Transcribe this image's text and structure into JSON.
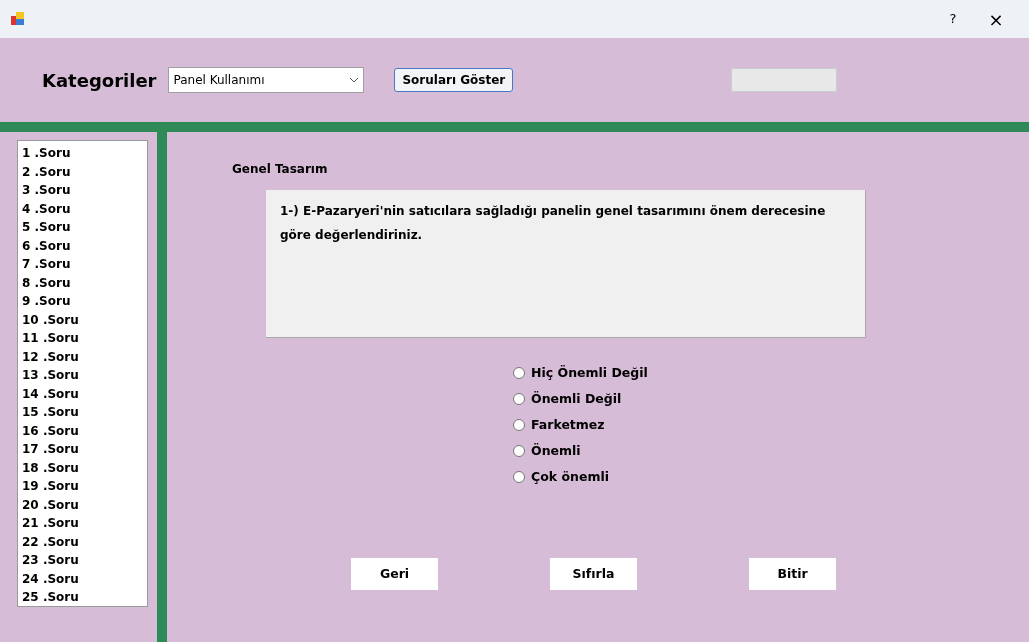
{
  "title_bar": {
    "help": "?",
    "close": "×"
  },
  "header": {
    "label": "Kategoriler",
    "category": "Panel Kullanımı",
    "show_button": "Soruları Göster"
  },
  "questions": [
    {
      "label": "1 .Soru"
    },
    {
      "label": "2 .Soru"
    },
    {
      "label": "3 .Soru"
    },
    {
      "label": "4 .Soru"
    },
    {
      "label": "5 .Soru"
    },
    {
      "label": "6 .Soru"
    },
    {
      "label": "7 .Soru"
    },
    {
      "label": "8 .Soru"
    },
    {
      "label": "9 .Soru"
    },
    {
      "label": "10 .Soru"
    },
    {
      "label": "11 .Soru"
    },
    {
      "label": "12 .Soru"
    },
    {
      "label": "13 .Soru"
    },
    {
      "label": "14 .Soru"
    },
    {
      "label": "15 .Soru"
    },
    {
      "label": "16 .Soru"
    },
    {
      "label": "17 .Soru"
    },
    {
      "label": "18 .Soru"
    },
    {
      "label": "19 .Soru"
    },
    {
      "label": "20 .Soru"
    },
    {
      "label": "21 .Soru"
    },
    {
      "label": "22 .Soru"
    },
    {
      "label": "23 .Soru"
    },
    {
      "label": "24 .Soru"
    },
    {
      "label": "25 .Soru"
    }
  ],
  "section": "Genel Tasarım",
  "question_text": "1-) E-Pazaryeri'nin satıcılara sağladığı panelin genel tasarımını önem derecesine göre değerlendiriniz.",
  "options": [
    {
      "label": "Hiç Önemli Değil",
      "selected": false
    },
    {
      "label": "Önemli Değil",
      "selected": false
    },
    {
      "label": "Farketmez",
      "selected": false
    },
    {
      "label": "Önemli",
      "selected": false
    },
    {
      "label": "Çok önemli",
      "selected": false
    }
  ],
  "buttons": [
    "Geri",
    "Sıfırla",
    "Bitir"
  ]
}
